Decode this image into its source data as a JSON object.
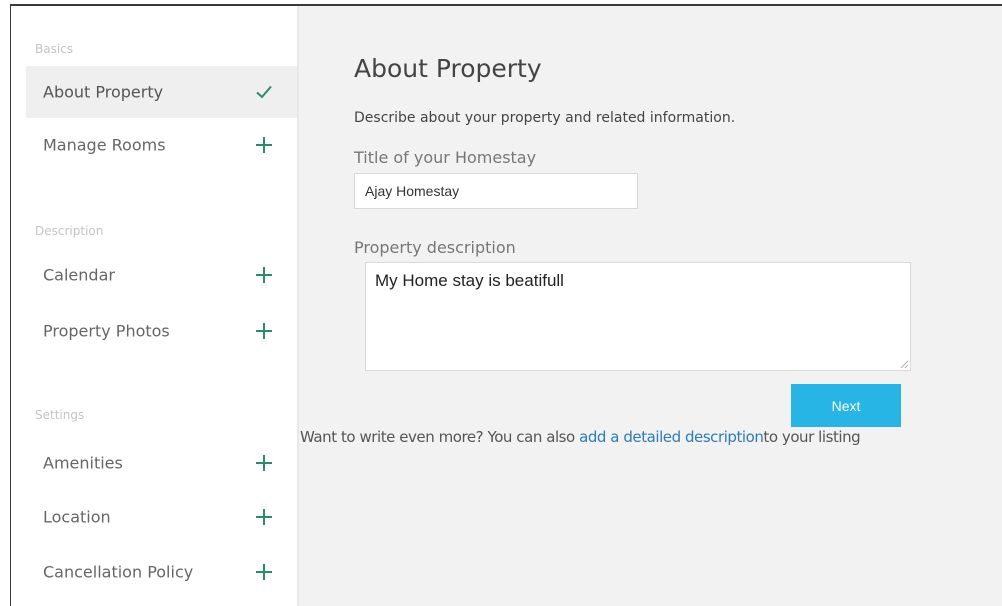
{
  "sidebar": {
    "sections": [
      {
        "heading": "Basics"
      },
      {
        "heading": "Description"
      },
      {
        "heading": "Settings"
      }
    ],
    "items": [
      {
        "label": "About Property",
        "icon": "check-icon",
        "active": true
      },
      {
        "label": "Manage Rooms",
        "icon": "plus-icon"
      },
      {
        "label": "Calendar",
        "icon": "plus-icon"
      },
      {
        "label": "Property Photos",
        "icon": "plus-icon"
      },
      {
        "label": "Amenities",
        "icon": "plus-icon"
      },
      {
        "label": "Location",
        "icon": "plus-icon"
      },
      {
        "label": "Cancellation Policy",
        "icon": "plus-icon"
      }
    ]
  },
  "main": {
    "title": "About Property",
    "subtitle": "Describe about your property and related information.",
    "homestay_title_label": "Title of your Homestay",
    "homestay_title_value": "Ajay Homestay",
    "description_label": "Property description",
    "description_value": "My Home stay is beatifull",
    "next_label": "Next",
    "more_prefix": "Want to write even more? You can also ",
    "more_link": "add a detailed description",
    "more_suffix": "to your listing"
  },
  "colors": {
    "accent": "#27b5e6",
    "icon_green": "#2a8a6a",
    "link": "#2c7cb5",
    "main_background": "#f2f2f2",
    "active_item_background": "#efefef"
  }
}
